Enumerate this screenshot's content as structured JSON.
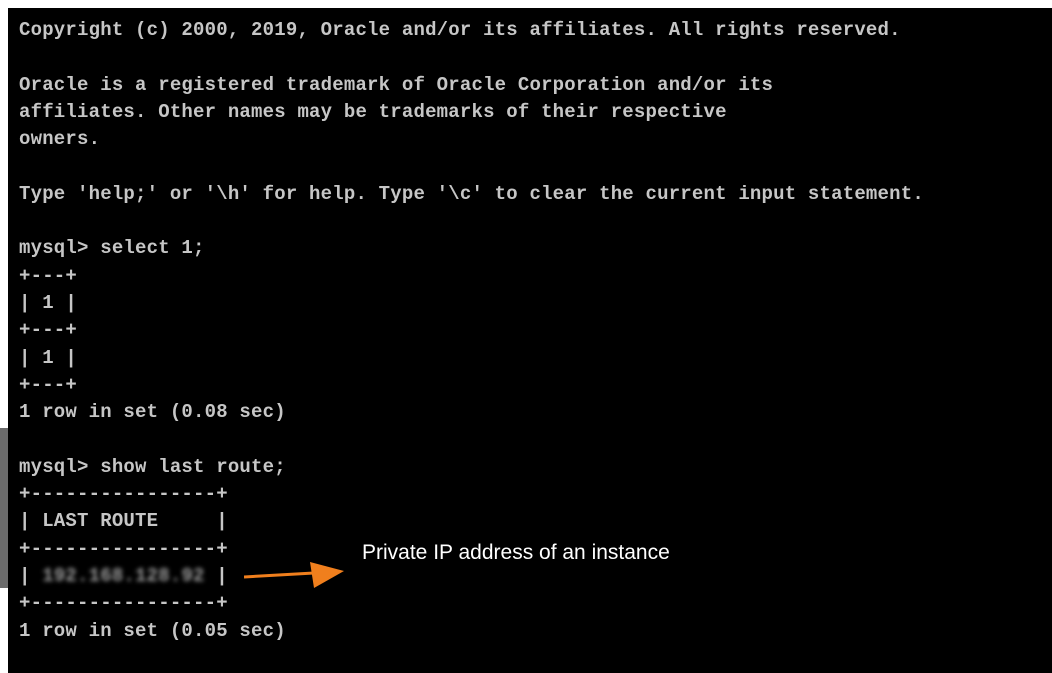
{
  "terminal": {
    "lines": [
      "Copyright (c) 2000, 2019, Oracle and/or its affiliates. All rights reserved.",
      "",
      "Oracle is a registered trademark of Oracle Corporation and/or its",
      "affiliates. Other names may be trademarks of their respective",
      "owners.",
      "",
      "Type 'help;' or '\\h' for help. Type '\\c' to clear the current input statement.",
      "",
      "mysql> select 1;",
      "+---+",
      "| 1 |",
      "+---+",
      "| 1 |",
      "+---+",
      "1 row in set (0.08 sec)",
      "",
      "mysql> show last route;",
      "+----------------+",
      "| LAST ROUTE     |",
      "+----------------+",
      "| 192.168.128.92 |",
      "+----------------+",
      "1 row in set (0.05 sec)"
    ],
    "blurred_value": "192.168.128.92",
    "text_color": "#c6c6c6",
    "background": "#000000"
  },
  "annotation": {
    "label": "Private IP address of an instance",
    "arrow_color": "#f07f1d",
    "arrow_icon": "arrow-right-icon"
  }
}
